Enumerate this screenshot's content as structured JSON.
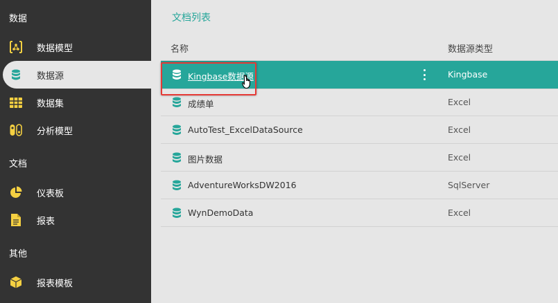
{
  "sidebar": {
    "sections": [
      {
        "title": "数据",
        "items": [
          {
            "label": "数据模型",
            "icon": "data-model-icon"
          },
          {
            "label": "数据源",
            "icon": "database-icon",
            "active": true
          },
          {
            "label": "数据集",
            "icon": "grid-table-icon"
          },
          {
            "label": "分析模型",
            "icon": "analysis-model-icon"
          }
        ]
      },
      {
        "title": "文档",
        "items": [
          {
            "label": "仪表板",
            "icon": "pie-chart-icon"
          },
          {
            "label": "报表",
            "icon": "report-document-icon"
          }
        ]
      },
      {
        "title": "其他",
        "items": [
          {
            "label": "报表模板",
            "icon": "cube-icon"
          }
        ]
      }
    ]
  },
  "main": {
    "title": "文档列表",
    "columns": {
      "name": "名称",
      "type": "数据源类型"
    },
    "rows": [
      {
        "name": "Kingbase数据源",
        "type": "Kingbase",
        "selected": true
      },
      {
        "name": "成绩单",
        "type": "Excel"
      },
      {
        "name": "AutoTest_ExcelDataSource",
        "type": "Excel"
      },
      {
        "name": "图片数据",
        "type": "Excel"
      },
      {
        "name": "AdventureWorksDW2016",
        "type": "SqlServer"
      },
      {
        "name": "WynDemoData",
        "type": "Excel"
      }
    ]
  },
  "colors": {
    "sidebar_bg": "#333333",
    "accent_teal": "#26a69a",
    "icon_yellow": "#f5d042",
    "highlight_red": "#e53935",
    "main_bg": "#e6e6e6"
  }
}
